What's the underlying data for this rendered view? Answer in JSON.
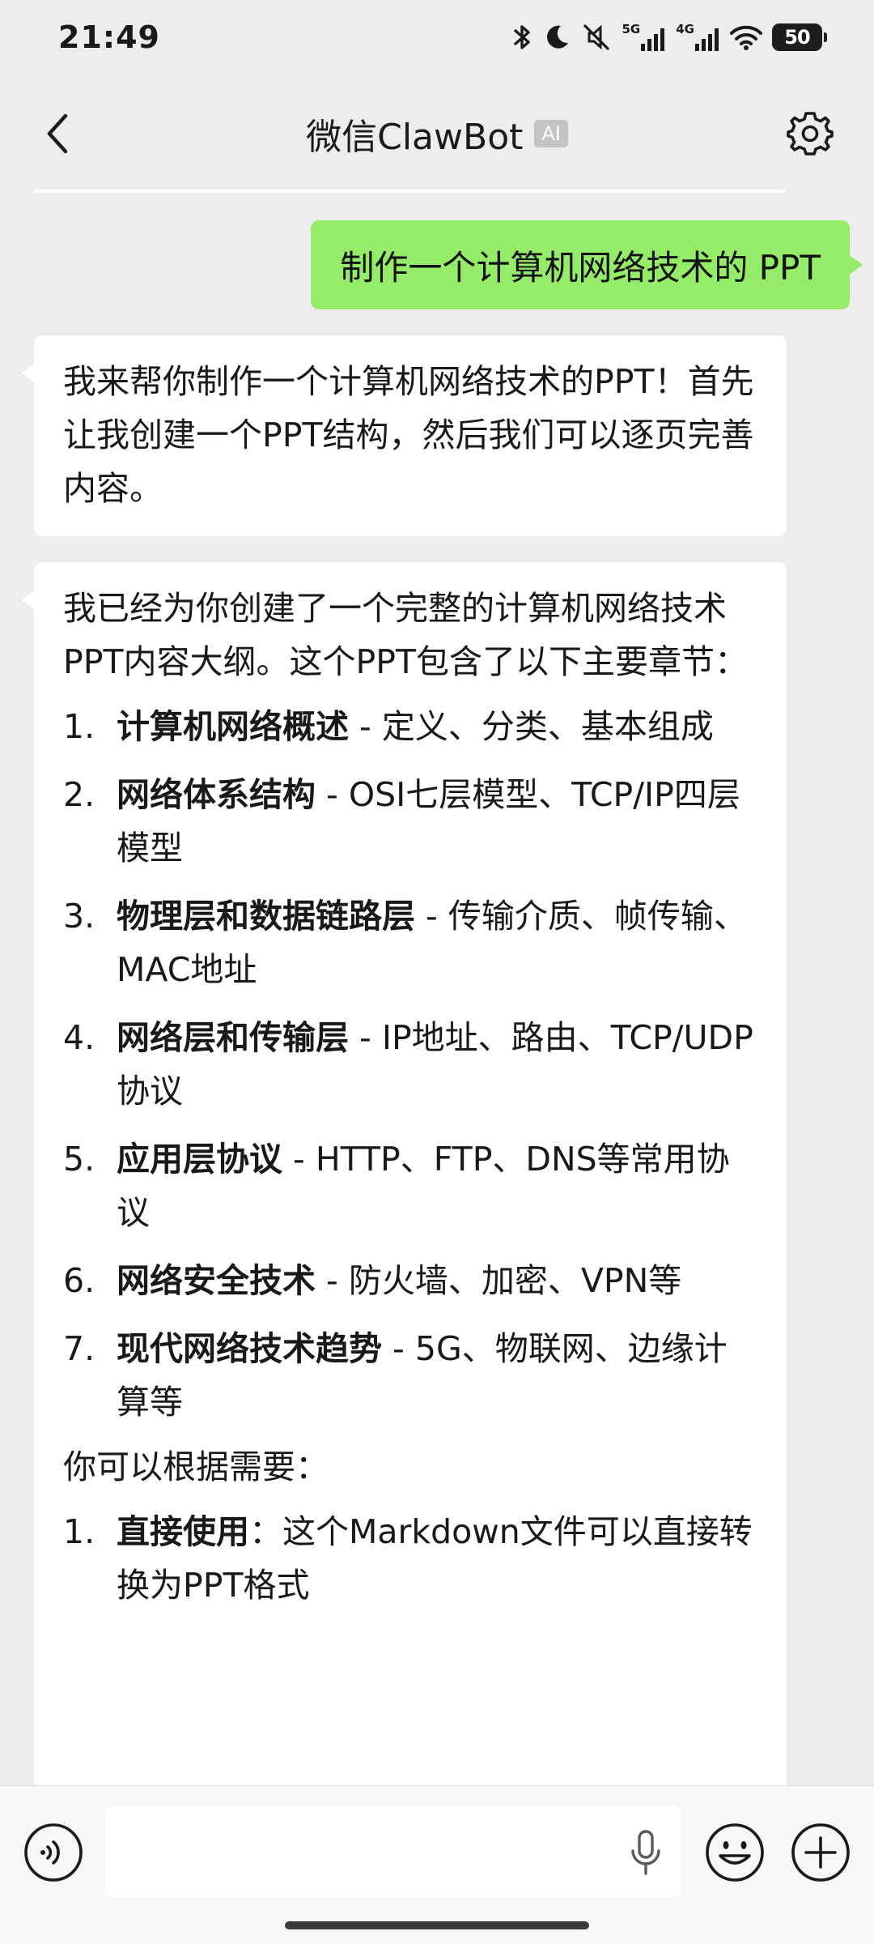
{
  "status": {
    "time": "21:49",
    "net1": "5G",
    "net2": "4G",
    "battery": "50"
  },
  "header": {
    "title": "微信ClawBot",
    "badge": "AI"
  },
  "messages": {
    "user": "制作一个计算机网络技术的 PPT",
    "reply1": "我来帮你制作一个计算机网络技术的PPT！首先让我创建一个PPT结构，然后我们可以逐页完善内容。",
    "reply2": {
      "intro": "我已经为你创建了一个完整的计算机网络技术PPT内容大纲。这个PPT包含了以下主要章节：",
      "chapters": [
        {
          "num": "1.",
          "title": "计算机网络概述",
          "desc": " - 定义、分类、基本组成"
        },
        {
          "num": "2.",
          "title": "网络体系结构",
          "desc": " - OSI七层模型、TCP/IP四层模型"
        },
        {
          "num": "3.",
          "title": "物理层和数据链路层",
          "desc": " - 传输介质、帧传输、MAC地址"
        },
        {
          "num": "4.",
          "title": "网络层和传输层",
          "desc": " - IP地址、路由、TCP/UDP协议"
        },
        {
          "num": "5.",
          "title": "应用层协议",
          "desc": " - HTTP、FTP、DNS等常用协议"
        },
        {
          "num": "6.",
          "title": "网络安全技术",
          "desc": " - 防火墙、加密、VPN等"
        },
        {
          "num": "7.",
          "title": "现代网络技术趋势",
          "desc": " - 5G、物联网、边缘计算等"
        }
      ],
      "outro": "你可以根据需要：",
      "options": [
        {
          "num": "1.",
          "title": "直接使用",
          "desc": "：这个Markdown文件可以直接转换为PPT格式"
        }
      ]
    }
  },
  "colors": {
    "background": "#ededed",
    "outgoing_bubble": "#95ec69",
    "incoming_bubble": "#ffffff",
    "input_bar": "#f7f7f7"
  },
  "icons": [
    "back-arrow-icon",
    "settings-gear-icon",
    "voice-icon",
    "microphone-icon",
    "emoji-icon",
    "plus-icon",
    "bluetooth-icon",
    "moon-icon",
    "mute-icon",
    "signal-icon",
    "wifi-icon",
    "battery-icon"
  ]
}
